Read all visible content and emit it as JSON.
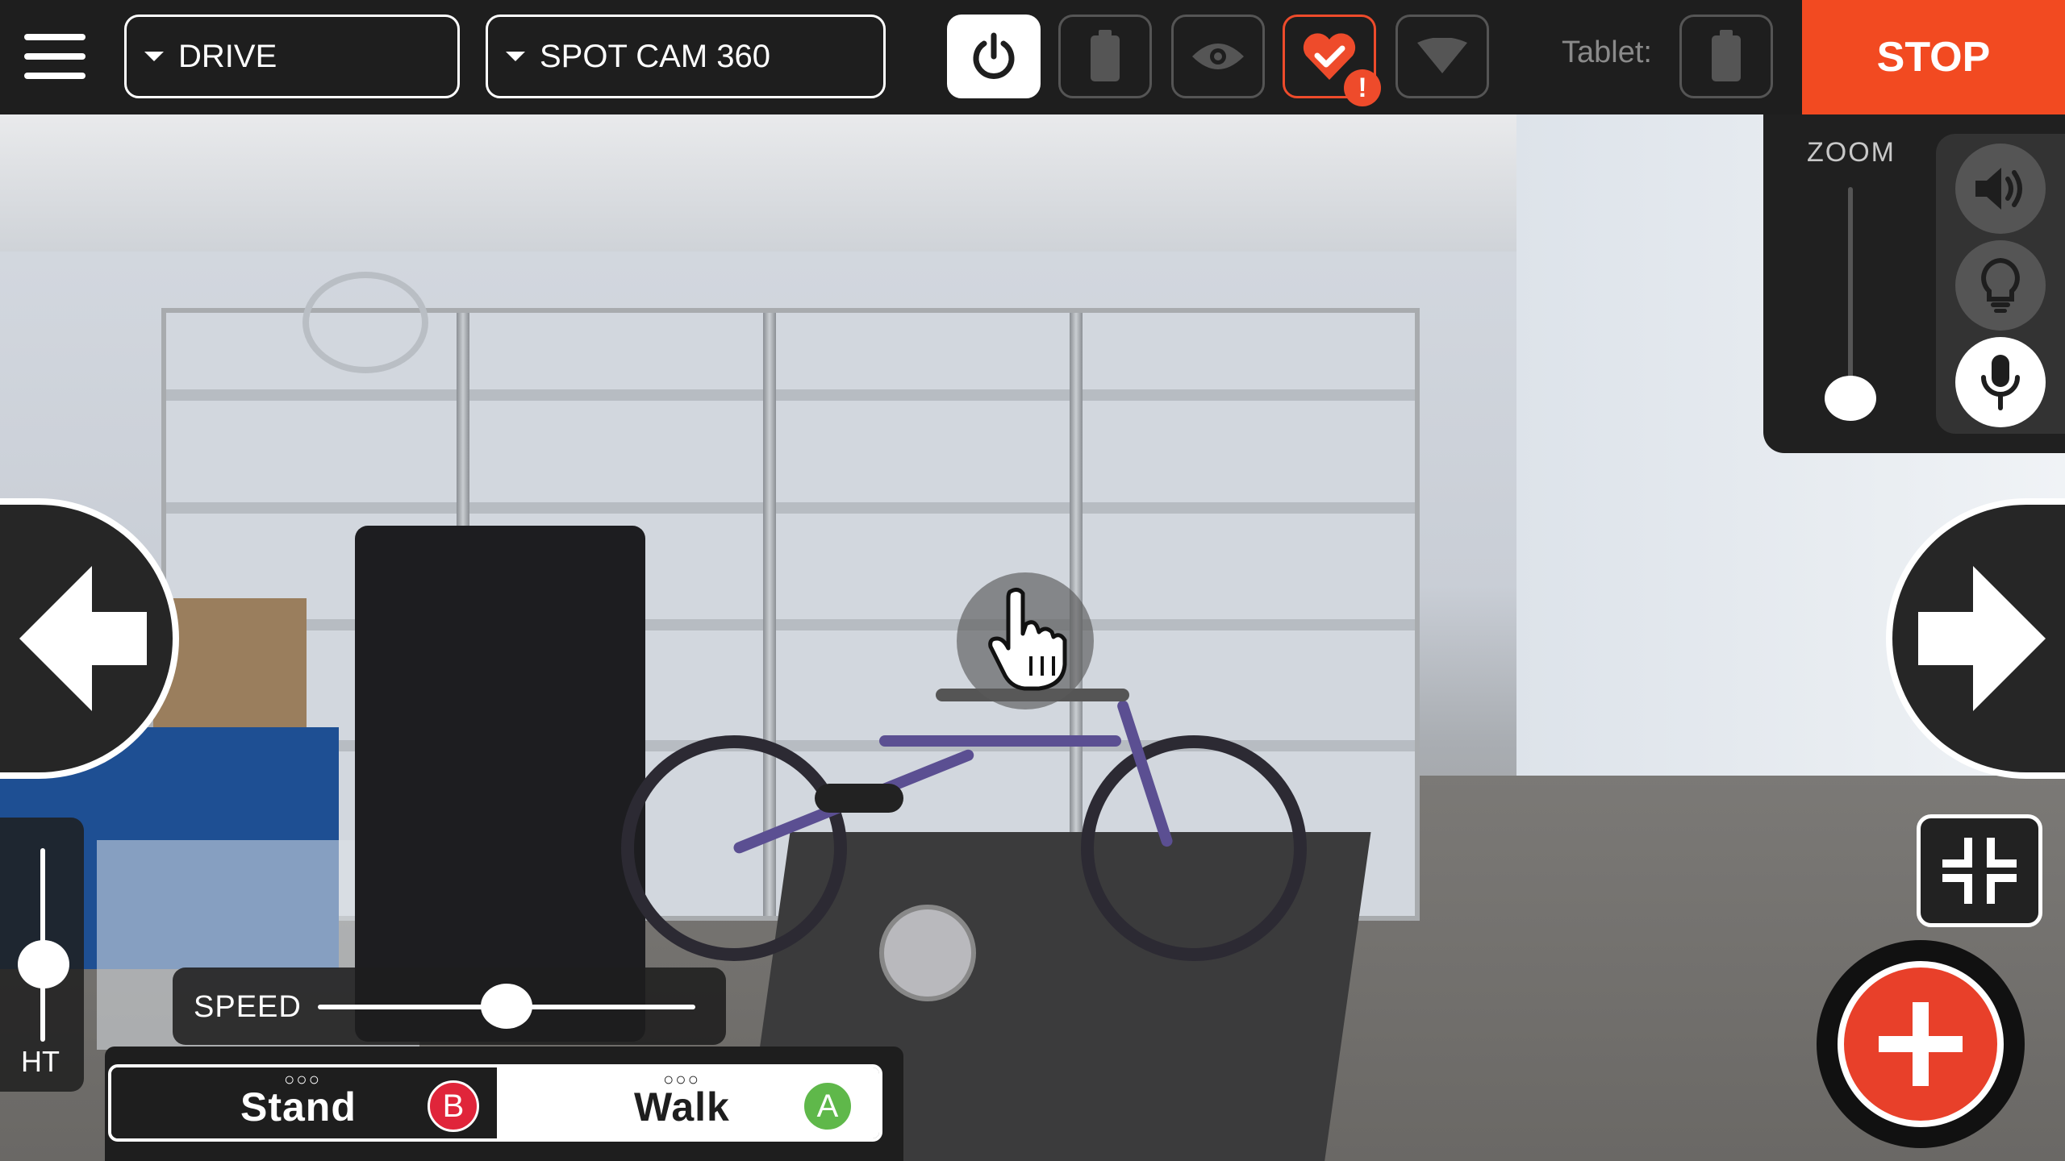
{
  "topbar": {
    "mode_dropdown": "DRIVE",
    "camera_dropdown": "SPOT CAM 360",
    "tablet_label": "Tablet:",
    "stop_label": "STOP"
  },
  "zoom": {
    "label": "ZOOM",
    "level": 0.1
  },
  "controls": {
    "height_label": "HT",
    "height_level": 0.4,
    "speed_label": "SPEED",
    "speed_level": 0.5
  },
  "modes": {
    "stand": {
      "label": "Stand",
      "badge": "B",
      "badge_color": "#e0253a"
    },
    "walk": {
      "label": "Walk",
      "badge": "A",
      "badge_color": "#5fb84a"
    },
    "selected": "walk"
  },
  "colors": {
    "stop": "#f24a21",
    "alert": "#ee4b2b",
    "add": "#e8402a"
  },
  "icons": [
    "menu-icon",
    "power-icon",
    "battery-icon",
    "eye-icon",
    "heart-check-icon",
    "wifi-icon",
    "tablet-battery-icon",
    "speaker-icon",
    "lightbulb-icon",
    "microphone-icon",
    "arrow-left-icon",
    "arrow-right-icon",
    "collapse-icon",
    "plus-icon",
    "hand-pointer-icon"
  ]
}
